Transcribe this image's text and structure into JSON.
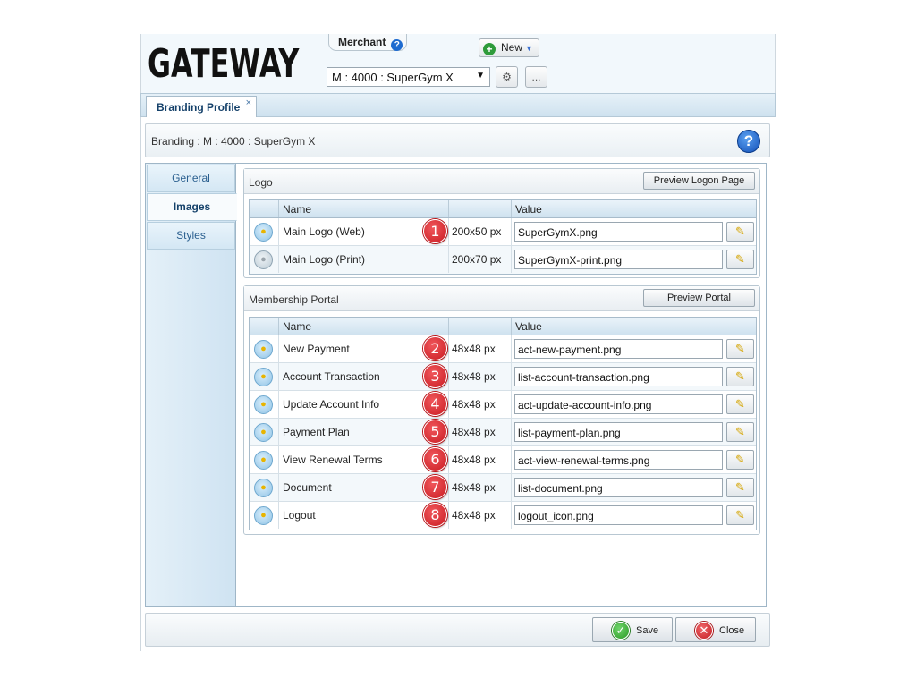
{
  "header": {
    "logo": "GATEWAY",
    "merchant_tab": "Merchant",
    "help_glyph": "?",
    "new_button": "New",
    "merchant_select": "M : 4000 : SuperGym X",
    "more_button": "..."
  },
  "tabs": [
    {
      "label": "Branding Profile",
      "close": "×"
    }
  ],
  "breadcrumb": "Branding : M : 4000 : SuperGym X",
  "sidebar": {
    "items": [
      {
        "label": "General"
      },
      {
        "label": "Images"
      },
      {
        "label": "Styles"
      }
    ],
    "active": "Images"
  },
  "logo_group": {
    "title": "Logo",
    "button": "Preview Logon Page",
    "columns": {
      "name": "Name",
      "size": "",
      "value": "Value"
    },
    "rows": [
      {
        "name": "Main Logo (Web)",
        "size": "200x50 px",
        "value": "SuperGymX.png",
        "marker": "1",
        "icon": "bulb-on"
      },
      {
        "name": "Main Logo (Print)",
        "size": "200x70 px",
        "value": "SuperGymX-print.png",
        "marker": "",
        "icon": "bulb-off"
      }
    ]
  },
  "portal_group": {
    "title": "Membership Portal",
    "button": "Preview Portal",
    "columns": {
      "name": "Name",
      "size": "",
      "value": "Value"
    },
    "rows": [
      {
        "name": "New Payment",
        "size": "48x48 px",
        "value": "act-new-payment.png",
        "marker": "2",
        "icon": "bulb-on"
      },
      {
        "name": "Account Transaction",
        "size": "48x48 px",
        "value": "list-account-transaction.png",
        "marker": "3",
        "icon": "bulb-on"
      },
      {
        "name": "Update Account Info",
        "size": "48x48 px",
        "value": "act-update-account-info.png",
        "marker": "4",
        "icon": "bulb-on"
      },
      {
        "name": "Payment Plan",
        "size": "48x48 px",
        "value": "list-payment-plan.png",
        "marker": "5",
        "icon": "bulb-on"
      },
      {
        "name": "View Renewal Terms",
        "size": "48x48 px",
        "value": "act-view-renewal-terms.png",
        "marker": "6",
        "icon": "bulb-on"
      },
      {
        "name": "Document",
        "size": "48x48 px",
        "value": "list-document.png",
        "marker": "7",
        "icon": "bulb-on"
      },
      {
        "name": "Logout",
        "size": "48x48 px",
        "value": "logout_icon.png",
        "marker": "8",
        "icon": "bulb-on"
      }
    ]
  },
  "footer": {
    "save": "Save",
    "close": "Close"
  },
  "colors": {
    "accent": "#15416a",
    "marker": "#d9252b",
    "save_icon": "#2a9a25",
    "close_icon": "#c41d22"
  }
}
